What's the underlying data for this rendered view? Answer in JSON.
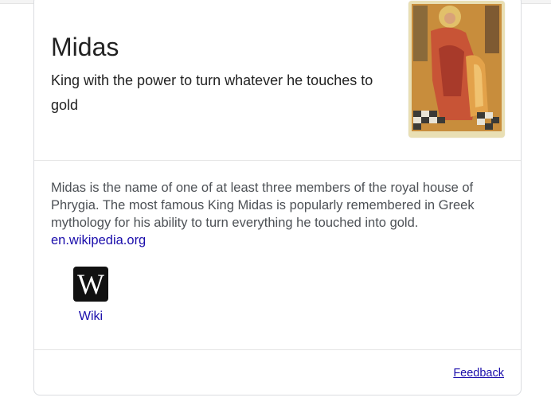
{
  "entity": {
    "title": "Midas",
    "subtitle": "King with the power to turn whatever he touches to gold",
    "image_icon": "painting-image"
  },
  "description": {
    "text": "Midas is the name of one of at least three members of the royal house of Phrygia. The most famous King Midas is popularly remembered in Greek mythology for his ability to turn everything he touched into gold.",
    "source_link": "en.wikipedia.org"
  },
  "profiles": [
    {
      "label": "Wiki",
      "icon": "wikipedia-icon",
      "logo_glyph": "W"
    }
  ],
  "footer": {
    "feedback_label": "Feedback"
  },
  "colors": {
    "link": "#1a0dab",
    "text": "#222222",
    "secondary_text": "#4d5156",
    "border": "#dadce0"
  }
}
